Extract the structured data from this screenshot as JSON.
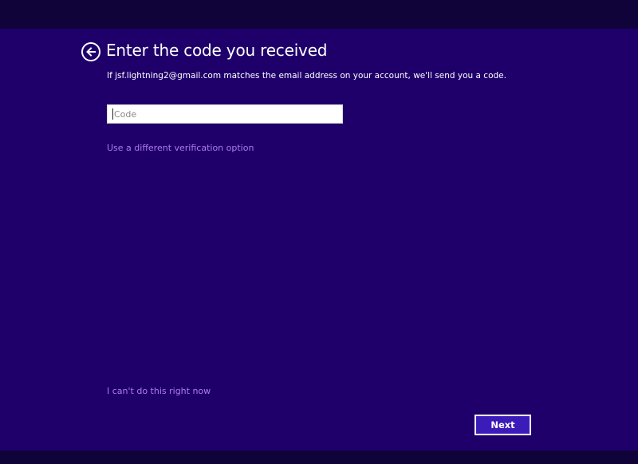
{
  "page": {
    "title": "Enter the code you received",
    "description": "If jsf.lightning2@gmail.com matches the email address on your account, we'll send you a code."
  },
  "back_button": {
    "icon": "back-arrow-icon"
  },
  "code_field": {
    "placeholder": "Code",
    "value": ""
  },
  "links": {
    "alternate_verification": "Use a different verification option",
    "skip": "I can't do this right now"
  },
  "buttons": {
    "next_label": "Next"
  },
  "colors": {
    "background_panel": "#1f006b",
    "background_outer": "#100339",
    "link": "#b07bf0",
    "button_fill": "#3c1cb8",
    "text": "#ffffff"
  }
}
